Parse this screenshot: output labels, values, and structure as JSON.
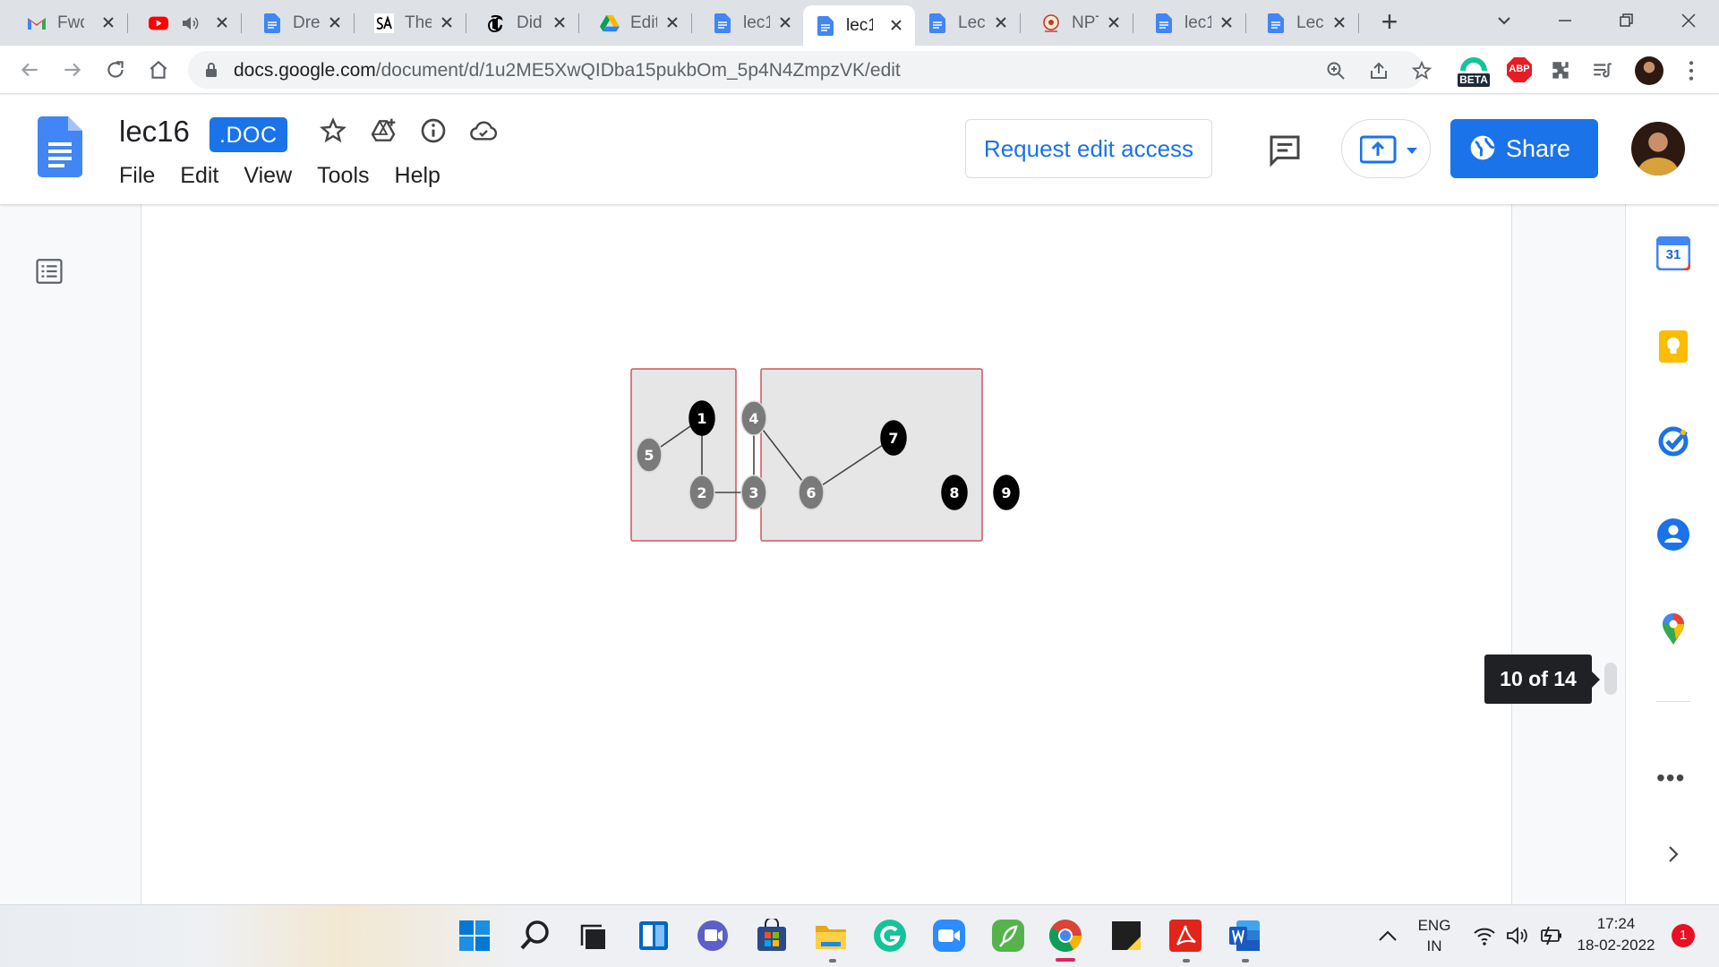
{
  "browser": {
    "tabs": [
      {
        "label": "Fwd",
        "icon": "gmail-icon"
      },
      {
        "label": "",
        "icon": "youtube-icon",
        "muted": true
      },
      {
        "label": "Dre",
        "icon": "docs-icon"
      },
      {
        "label": "The",
        "icon": "sa-icon"
      },
      {
        "label": "Did",
        "icon": "nyt-icon"
      },
      {
        "label": "Edit",
        "icon": "drive-icon"
      },
      {
        "label": "lec1",
        "icon": "docs-icon"
      },
      {
        "label": "lec1",
        "icon": "docs-icon",
        "active": true
      },
      {
        "label": "Lec",
        "icon": "docs-icon"
      },
      {
        "label": "NPT",
        "icon": "nptel-icon"
      },
      {
        "label": "lec1",
        "icon": "docs-icon"
      },
      {
        "label": "Lec",
        "icon": "docs-icon"
      }
    ],
    "url_host": "docs.google.com",
    "url_path": "/document/d/1u2ME5XwQIDba15pukbOm_5p4N4ZmpzVK/edit",
    "extensions": {
      "beta_label": "BETA",
      "abp_label": "ABP"
    }
  },
  "doc": {
    "title": "lec16",
    "badge": ".DOC",
    "menu": [
      "File",
      "Edit",
      "View",
      "Tools",
      "Help"
    ],
    "request_edit_label": "Request edit access",
    "share_label": "Share",
    "page_indicator": "10 of 14"
  },
  "figure": {
    "nodes": [
      {
        "id": "1",
        "color": "black"
      },
      {
        "id": "2",
        "color": "gray"
      },
      {
        "id": "3",
        "color": "gray"
      },
      {
        "id": "4",
        "color": "gray"
      },
      {
        "id": "5",
        "color": "gray"
      },
      {
        "id": "6",
        "color": "gray"
      },
      {
        "id": "7",
        "color": "black"
      },
      {
        "id": "8",
        "color": "black"
      },
      {
        "id": "9",
        "color": "black"
      }
    ],
    "edges": [
      [
        "5",
        "1"
      ],
      [
        "1",
        "2"
      ],
      [
        "2",
        "3"
      ],
      [
        "4",
        "3"
      ],
      [
        "4",
        "6"
      ],
      [
        "6",
        "7"
      ]
    ],
    "groups": [
      [
        "1",
        "2",
        "5"
      ],
      [
        "3",
        "4",
        "6",
        "7"
      ]
    ]
  },
  "side_panel": {
    "calendar_day": "31"
  },
  "taskbar": {
    "lang_top": "ENG",
    "lang_bottom": "IN",
    "time": "17:24",
    "date": "18-02-2022",
    "notifications": "1"
  }
}
